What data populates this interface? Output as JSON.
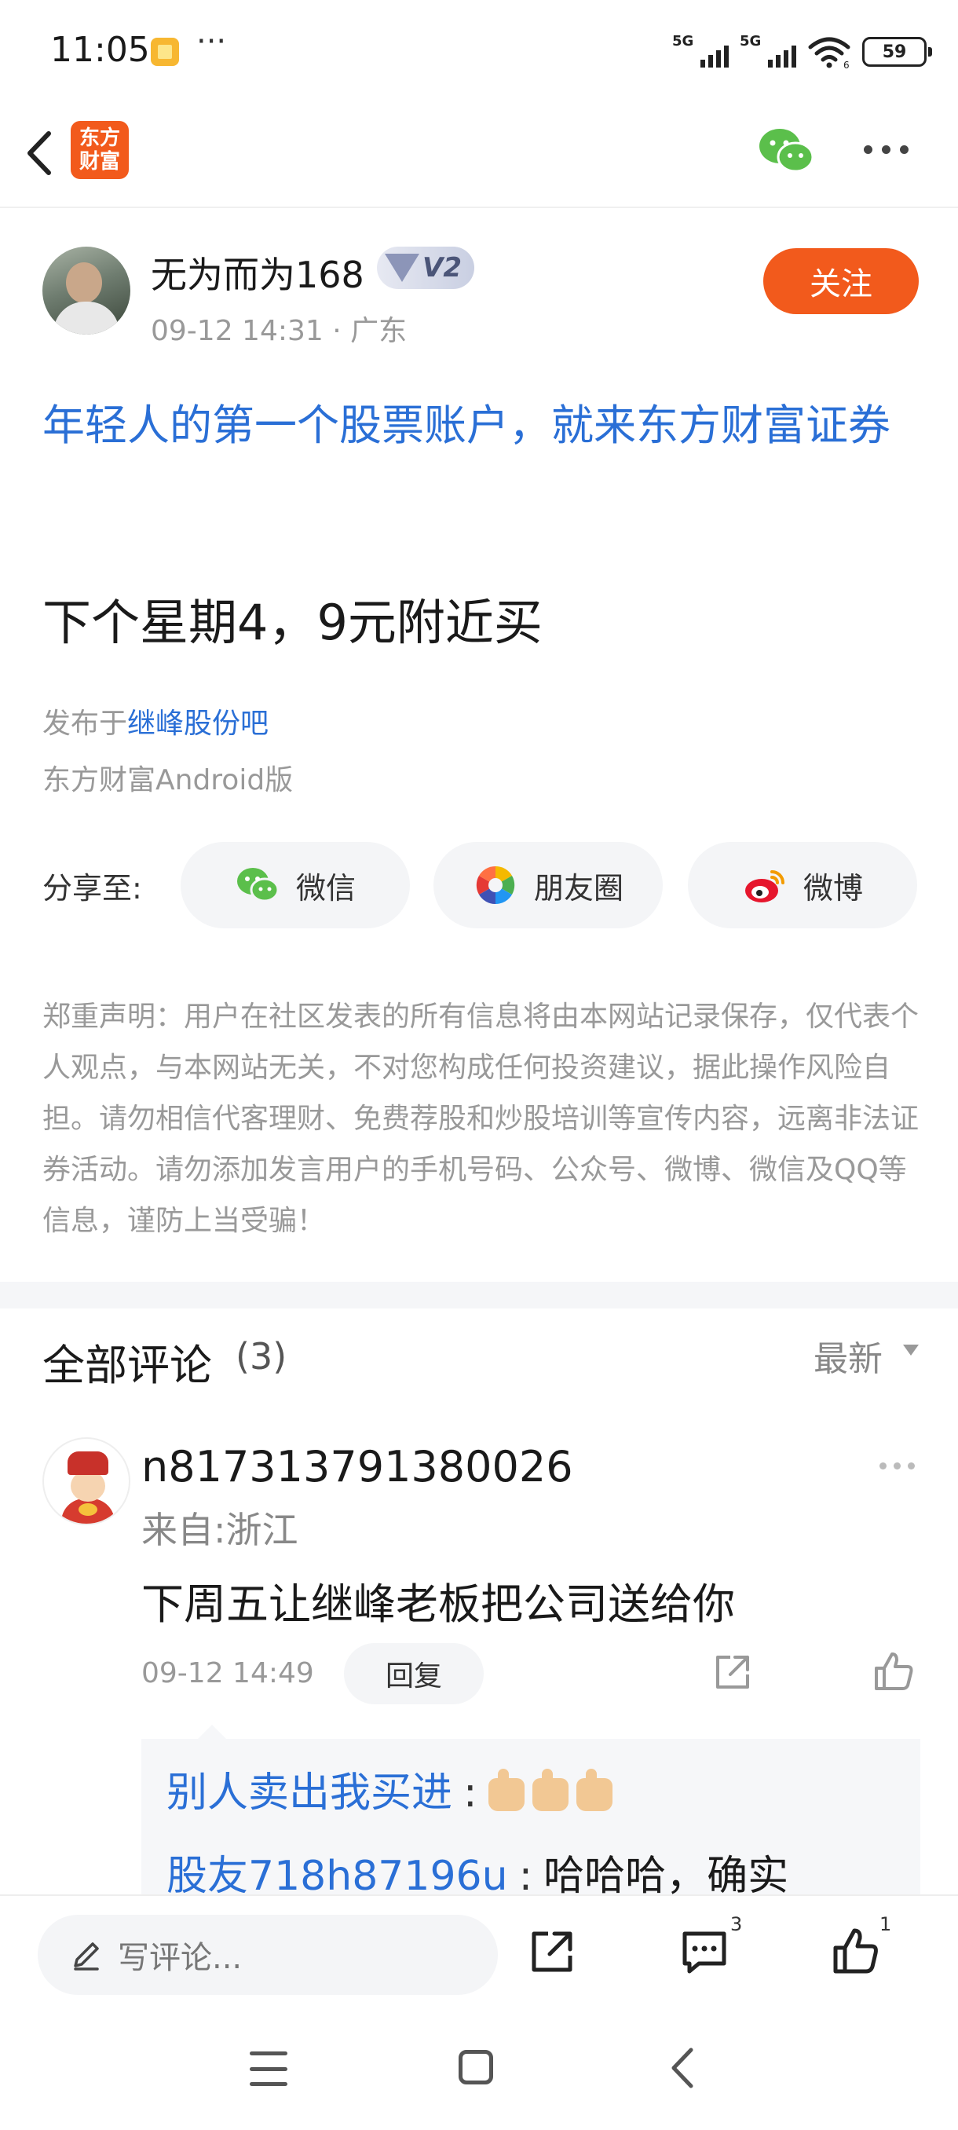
{
  "status_bar": {
    "time": "11:05",
    "dots": "···",
    "network1": "5G",
    "network2": "5G",
    "wifi_sub": "6",
    "battery": "59"
  },
  "nav": {
    "logo_text_line1": "东方",
    "logo_text_line2": "财富"
  },
  "author": {
    "name": "无为而为168",
    "badge": "V2",
    "meta": "09-12 14:31 · 广东",
    "follow_label": "关注"
  },
  "post": {
    "promo": "年轻人的第一个股票账户，就来东方财富证券",
    "body": "下个星期4，9元附近买",
    "published_prefix": "发布于",
    "published_bar": "继峰股份吧",
    "client": "东方财富Android版"
  },
  "share": {
    "label": "分享至:",
    "wechat": "微信",
    "moments": "朋友圈",
    "weibo": "微博"
  },
  "disclaimer": "郑重声明：用户在社区发表的所有信息将由本网站记录保存，仅代表个人观点，与本网站无关，不对您构成任何投资建议，据此操作风险自担。请勿相信代客理财、免费荐股和炒股培训等宣传内容，远离非法证券活动。请勿添加发言用户的手机号码、公众号、微博、微信及QQ等信息，谨防上当受骗！",
  "comments": {
    "title": "全部评论",
    "count": "(3)",
    "sort": "最新",
    "items": [
      {
        "user": "n817313791380026",
        "location": "来自:浙江",
        "text": "下周五让继峰老板把公司送给你",
        "time": "09-12 14:49",
        "reply_label": "回复",
        "replies": [
          {
            "user": "别人卖出我买进",
            "sep": ":",
            "text": ""
          },
          {
            "user": "股友718h87196u",
            "sep": ":",
            "text": "哈哈哈，确实"
          }
        ]
      }
    ]
  },
  "bottom_bar": {
    "write_placeholder": "写评论...",
    "comment_count": "3",
    "like_count": "1"
  },
  "colors": {
    "accent": "#f25a1c",
    "link": "#2a6fd6",
    "muted": "#999999"
  }
}
